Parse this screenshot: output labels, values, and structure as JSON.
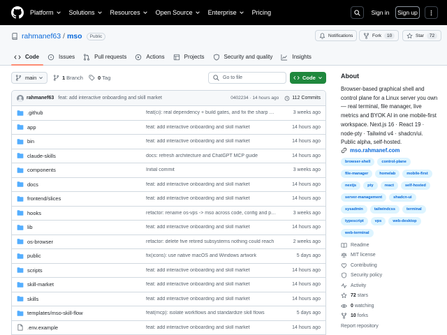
{
  "header": {
    "nav": [
      {
        "label": "Platform",
        "dropdown": true
      },
      {
        "label": "Solutions",
        "dropdown": true
      },
      {
        "label": "Resources",
        "dropdown": true
      },
      {
        "label": "Open Source",
        "dropdown": true
      },
      {
        "label": "Enterprise",
        "dropdown": true
      },
      {
        "label": "Pricing",
        "dropdown": false
      }
    ],
    "signin_label": "Sign in",
    "signup_label": "Sign up"
  },
  "repo": {
    "owner": "rahmanef63",
    "name": "mso",
    "visibility": "Public",
    "notifications_label": "Notifications",
    "fork_label": "Fork",
    "fork_count": "10",
    "star_label": "Star",
    "star_count": "72",
    "tabs": [
      {
        "label": "Code",
        "icon": "code-icon",
        "active": true
      },
      {
        "label": "Issues",
        "icon": "issue-icon",
        "active": false
      },
      {
        "label": "Pull requests",
        "icon": "pull-request-icon",
        "active": false
      },
      {
        "label": "Actions",
        "icon": "play-icon",
        "active": false
      },
      {
        "label": "Projects",
        "icon": "table-icon",
        "active": false
      },
      {
        "label": "Security and quality",
        "icon": "shield-icon",
        "active": false
      },
      {
        "label": "Insights",
        "icon": "graph-icon",
        "active": false
      }
    ]
  },
  "browser": {
    "branch": "main",
    "branch_count": "1",
    "branch_label": "Branch",
    "tag_count": "0",
    "tag_label": "Tag",
    "search_placeholder": "Go to file",
    "code_label": "Code"
  },
  "commit": {
    "author": "rahmanef63",
    "message": "feat: add interactive onboarding and skill market",
    "meta": "0402234 · 14 hours ago",
    "count_label": "112 Commits"
  },
  "files": [
    {
      "name": ".github",
      "type": "folder",
      "message": "feat(ci): real dependency + build gates, and fix the sharp CV...",
      "date": "3 weeks ago"
    },
    {
      "name": "app",
      "type": "folder",
      "message": "feat: add interactive onboarding and skill market",
      "date": "14 hours ago"
    },
    {
      "name": "bin",
      "type": "folder",
      "message": "feat: add interactive onboarding and skill market",
      "date": "14 hours ago"
    },
    {
      "name": "claude-skills",
      "type": "folder",
      "message": "docs: refresh architecture and ChatGPT MCP guide",
      "date": "14 hours ago"
    },
    {
      "name": "components",
      "type": "folder",
      "message": "Initial commit",
      "date": "3 weeks ago"
    },
    {
      "name": "docs",
      "type": "folder",
      "message": "feat: add interactive onboarding and skill market",
      "date": "14 hours ago"
    },
    {
      "name": "frontend/slices",
      "type": "folder",
      "message": "feat: add interactive onboarding and skill market",
      "date": "14 hours ago"
    },
    {
      "name": "hooks",
      "type": "folder",
      "message": "refactor: rename os-vps -> mso across code, config and pro...",
      "date": "3 weeks ago"
    },
    {
      "name": "lib",
      "type": "folder",
      "message": "feat: add interactive onboarding and skill market",
      "date": "14 hours ago"
    },
    {
      "name": "os-browser",
      "type": "folder",
      "message": "refactor: delete five retired subsystems nothing could reach",
      "date": "2 weeks ago"
    },
    {
      "name": "public",
      "type": "folder",
      "message": "fix(icons): use native macOS and Windows artwork",
      "date": "5 days ago"
    },
    {
      "name": "scripts",
      "type": "folder",
      "message": "feat: add interactive onboarding and skill market",
      "date": "14 hours ago"
    },
    {
      "name": "skill-market",
      "type": "folder",
      "message": "feat: add interactive onboarding and skill market",
      "date": "14 hours ago"
    },
    {
      "name": "skills",
      "type": "folder",
      "message": "feat: add interactive onboarding and skill market",
      "date": "14 hours ago"
    },
    {
      "name": "templates/mso-skill-flow",
      "type": "folder",
      "message": "feat(mcp): isolate workflows and standardize skill flows",
      "date": "5 days ago"
    },
    {
      "name": ".env.example",
      "type": "file",
      "message": "feat: add interactive onboarding and skill market",
      "date": "14 hours ago"
    }
  ],
  "about": {
    "title": "About",
    "description": "Browser-based graphical shell and control plane for a Linux server you own — real terminal, file manager, live metrics and BYOK AI in one mobile-first workspace. Next.js 16 · React 19 · node-pty · Tailwind v4 · shadcn/ui. Public alpha, self-hosted.",
    "url": "mso.rahmanef.com",
    "topics": [
      "browser-shell",
      "control-plane",
      "file-manager",
      "homelab",
      "mobile-first",
      "nextjs",
      "pty",
      "react",
      "self-hosted",
      "server-management",
      "shadcn-ui",
      "sysadmin",
      "tailwindcss",
      "terminal",
      "typescript",
      "vps",
      "web-desktop",
      "web-terminal"
    ],
    "stats": [
      {
        "icon": "book-icon",
        "bold": "",
        "label": "Readme"
      },
      {
        "icon": "law-icon",
        "bold": "",
        "label": "MIT license"
      },
      {
        "icon": "heart-pulse-icon",
        "bold": "",
        "label": "Contributing"
      },
      {
        "icon": "scale-icon",
        "bold": "",
        "label": "Security policy"
      },
      {
        "icon": "pulse-icon",
        "bold": "",
        "label": "Activity"
      },
      {
        "icon": "star-icon",
        "bold": "72",
        "label": "stars"
      },
      {
        "icon": "eye-icon",
        "bold": "0",
        "label": "watching"
      },
      {
        "icon": "fork-icon",
        "bold": "10",
        "label": "forks"
      },
      {
        "icon": "",
        "bold": "",
        "label": "Report repository"
      }
    ]
  },
  "colors": {
    "header_bg": "#000000",
    "link": "#0969da",
    "primary_button": "#1f883d",
    "folder": "#54aeff",
    "tab_underline": "#fd8c73"
  }
}
